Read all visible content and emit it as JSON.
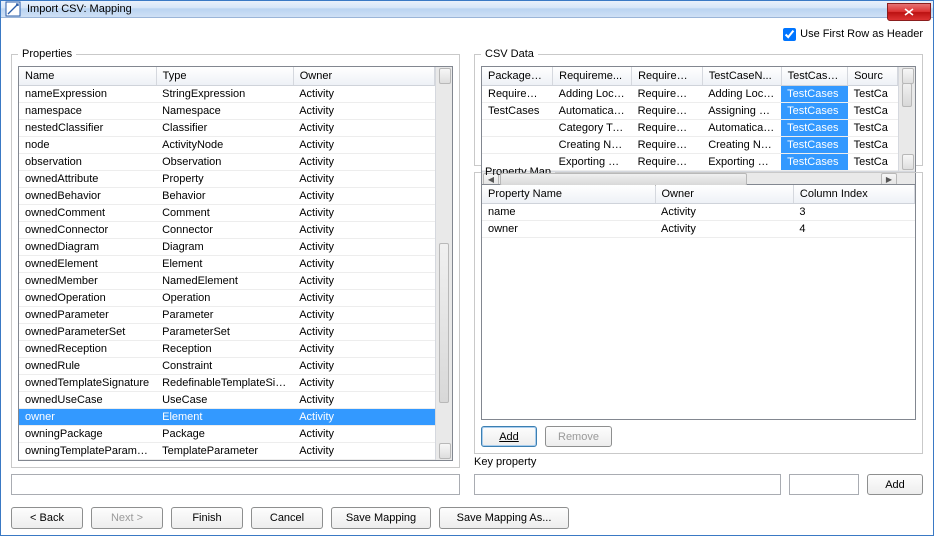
{
  "window": {
    "title": "Import CSV: Mapping"
  },
  "header_checkbox": {
    "label": "Use First Row as Header",
    "checked": true
  },
  "properties_group": {
    "legend": "Properties",
    "columns": [
      "Name",
      "Type",
      "Owner"
    ],
    "rows": [
      {
        "name": "nameExpression",
        "type": "StringExpression",
        "owner": "Activity"
      },
      {
        "name": "namespace",
        "type": "Namespace",
        "owner": "Activity"
      },
      {
        "name": "nestedClassifier",
        "type": "Classifier",
        "owner": "Activity"
      },
      {
        "name": "node",
        "type": "ActivityNode",
        "owner": "Activity"
      },
      {
        "name": "observation",
        "type": "Observation",
        "owner": "Activity"
      },
      {
        "name": "ownedAttribute",
        "type": "Property",
        "owner": "Activity"
      },
      {
        "name": "ownedBehavior",
        "type": "Behavior",
        "owner": "Activity"
      },
      {
        "name": "ownedComment",
        "type": "Comment",
        "owner": "Activity"
      },
      {
        "name": "ownedConnector",
        "type": "Connector",
        "owner": "Activity"
      },
      {
        "name": "ownedDiagram",
        "type": "Diagram",
        "owner": "Activity"
      },
      {
        "name": "ownedElement",
        "type": "Element",
        "owner": "Activity"
      },
      {
        "name": "ownedMember",
        "type": "NamedElement",
        "owner": "Activity"
      },
      {
        "name": "ownedOperation",
        "type": "Operation",
        "owner": "Activity"
      },
      {
        "name": "ownedParameter",
        "type": "Parameter",
        "owner": "Activity"
      },
      {
        "name": "ownedParameterSet",
        "type": "ParameterSet",
        "owner": "Activity"
      },
      {
        "name": "ownedReception",
        "type": "Reception",
        "owner": "Activity"
      },
      {
        "name": "ownedRule",
        "type": "Constraint",
        "owner": "Activity"
      },
      {
        "name": "ownedTemplateSignature",
        "type": "RedefinableTemplateSigna...",
        "owner": "Activity"
      },
      {
        "name": "ownedUseCase",
        "type": "UseCase",
        "owner": "Activity"
      },
      {
        "name": "owner",
        "type": "Element",
        "owner": "Activity",
        "selected": true
      },
      {
        "name": "owningPackage",
        "type": "Package",
        "owner": "Activity"
      },
      {
        "name": "owningTemplateParameter",
        "type": "TemplateParameter",
        "owner": "Activity"
      }
    ],
    "filter_value": ""
  },
  "csv_group": {
    "legend": "CSV Data",
    "columns": [
      "PackageNa...",
      "Requireme...",
      "Requireme...",
      "TestCaseN...",
      "TestCaseO...",
      "Sourc"
    ],
    "rows": [
      {
        "c": [
          "Requirement",
          "Adding Local...",
          "Requirement",
          "Adding Local...",
          "TestCases",
          "TestCa"
        ],
        "hl": [
          4
        ]
      },
      {
        "c": [
          "TestCases",
          "Automaticall...",
          "Requirement",
          "Assigning Pr...",
          "TestCases",
          "TestCa"
        ],
        "hl": [
          4
        ]
      },
      {
        "c": [
          "",
          "Category Ty...",
          "Requirement",
          "Automaticall...",
          "TestCases",
          "TestCa"
        ],
        "hl": [
          4
        ]
      },
      {
        "c": [
          "",
          "Creating Ne...",
          "Requirement",
          "Creating Ne...",
          "TestCases",
          "TestCa"
        ],
        "hl": [
          4
        ]
      },
      {
        "c": [
          "",
          "Exporting M...",
          "Requirement",
          "Exporting m...",
          "TestCases",
          "TestCa"
        ],
        "hl": [
          4
        ]
      }
    ]
  },
  "property_map": {
    "legend": "Property Map",
    "columns": [
      "Property Name",
      "Owner",
      "Column Index"
    ],
    "rows": [
      {
        "name": "name",
        "owner": "Activity",
        "index": "3"
      },
      {
        "name": "owner",
        "owner": "Activity",
        "index": "4"
      }
    ],
    "add_label": "Add",
    "remove_label": "Remove"
  },
  "key_property": {
    "label": "Key property",
    "value1": "",
    "value2": "",
    "add_label": "Add"
  },
  "buttons": {
    "back": "< Back",
    "next": "Next >",
    "finish": "Finish",
    "cancel": "Cancel",
    "save_mapping": "Save Mapping",
    "save_mapping_as": "Save Mapping As..."
  }
}
